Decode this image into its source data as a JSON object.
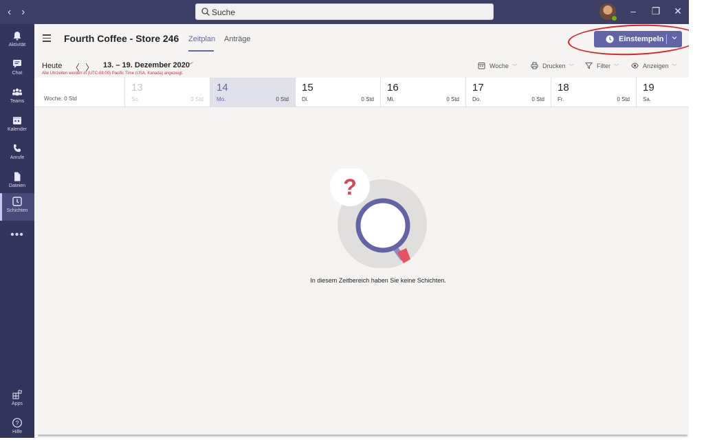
{
  "titlebar": {
    "back_label": "‹",
    "forward_label": "›",
    "search_placeholder": "Suche",
    "minimize_label": "–",
    "restore_label": "❐",
    "close_label": "✕"
  },
  "rail": {
    "items": [
      {
        "label": "Aktivität",
        "icon": "bell-icon"
      },
      {
        "label": "Chat",
        "icon": "chat-icon"
      },
      {
        "label": "Teams",
        "icon": "teams-icon"
      },
      {
        "label": "Kalender",
        "icon": "calendar-icon"
      },
      {
        "label": "Anrufe",
        "icon": "phone-icon"
      },
      {
        "label": "Dateien",
        "icon": "file-icon"
      },
      {
        "label": "Schichten",
        "icon": "shifts-icon"
      }
    ],
    "more_label": "•••",
    "apps_label": "Apps",
    "help_label": "Hilfe"
  },
  "header": {
    "title": "Fourth Coffee - Store 246",
    "tabs": [
      {
        "label": "Zeitplan",
        "active": true
      },
      {
        "label": "Anträge",
        "active": false
      }
    ],
    "clock_in_label": "Einstempeln"
  },
  "toolbar": {
    "today_label": "Heute",
    "prev_label": "〈",
    "next_label": "〉",
    "date_range": "13. – 19. Dezember 2020",
    "timezone_note": "Alle Uhrzeiten werden in (UTC-08:00) Pacific Time (USA, Kanada) angezeigt.",
    "week_label": "Woche",
    "print_label": "Drucken",
    "filter_label": "Filter",
    "view_label": "Anzeigen"
  },
  "week_summary": "Woche: 0 Std",
  "days": [
    {
      "num": "13",
      "label": "So.",
      "hours": "0 Std",
      "state": "past"
    },
    {
      "num": "14",
      "label": "Mo.",
      "hours": "0 Std",
      "state": "current"
    },
    {
      "num": "15",
      "label": "Di.",
      "hours": "0 Std",
      "state": "normal"
    },
    {
      "num": "16",
      "label": "Mi.",
      "hours": "0 Std",
      "state": "normal"
    },
    {
      "num": "17",
      "label": "Do.",
      "hours": "0 Std",
      "state": "normal"
    },
    {
      "num": "18",
      "label": "Fr.",
      "hours": "0 Std",
      "state": "normal"
    },
    {
      "num": "19",
      "label": "Sa.",
      "hours": "",
      "state": "normal"
    }
  ],
  "empty_state": {
    "message": "In diesem Zeitbereich haben Sie keine Schichten.",
    "question_mark": "?"
  },
  "colors": {
    "accent": "#6264a7",
    "titlebar": "#3d3e66",
    "rail": "#34355c",
    "annotation": "#d82020"
  }
}
